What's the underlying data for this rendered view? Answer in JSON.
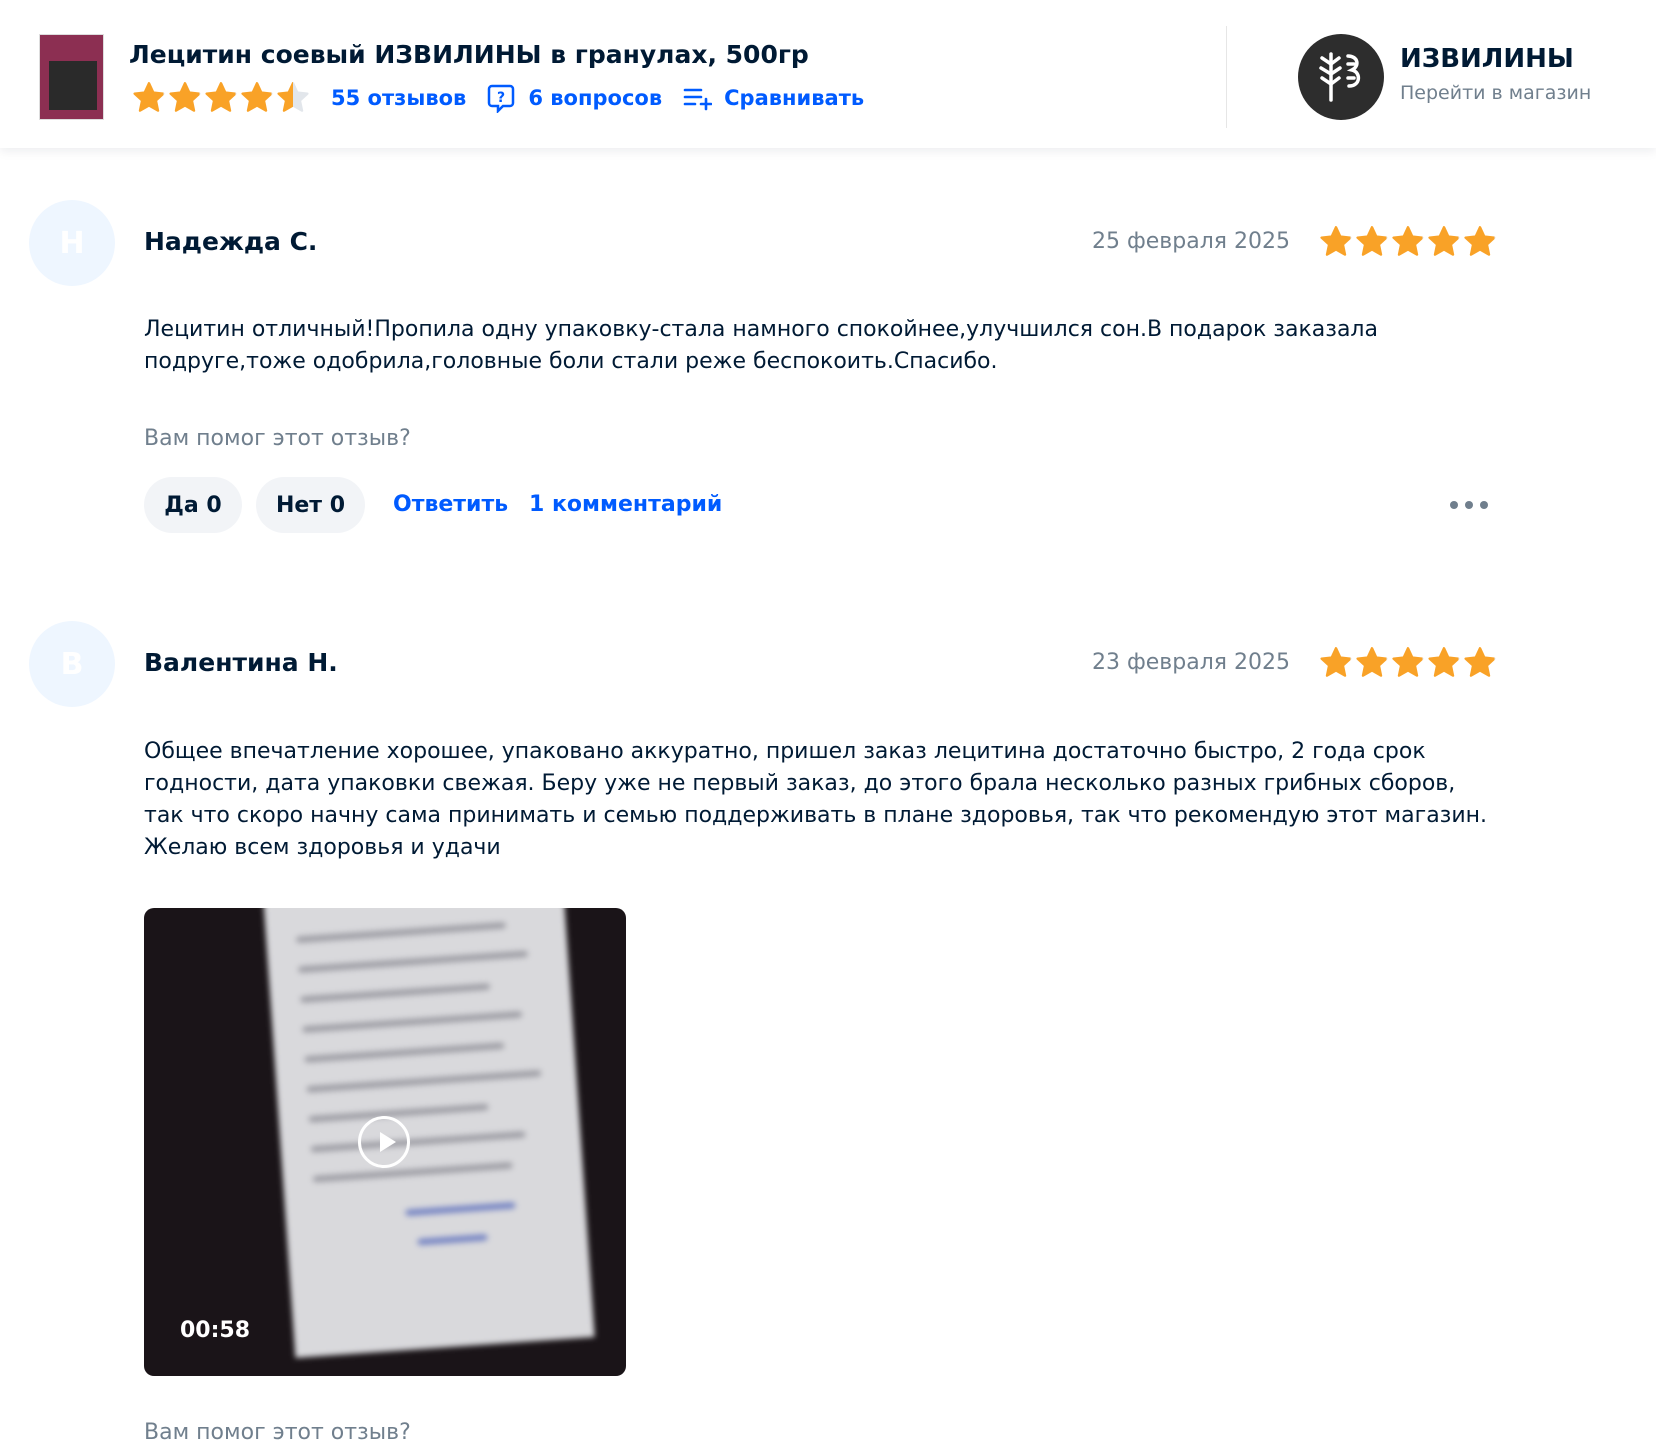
{
  "product": {
    "title": "Лецитин соевый ИЗВИЛИНЫ в гранулах, 500гр",
    "rating": 4.5,
    "reviews_link": "55 отзывов",
    "questions_link": "6 вопросов",
    "compare_link": "Сравнивать"
  },
  "store": {
    "name": "ИЗВИЛИНЫ",
    "link": "Перейти в магазин"
  },
  "colors": {
    "accent": "#005bff",
    "star": "#f9a227",
    "text": "#001a34",
    "muted": "#707f8d"
  },
  "reviews": [
    {
      "initial": "Н",
      "author": "Надежда С.",
      "date": "25 февраля 2025",
      "rating": 5,
      "text": "Лецитин отличный!Пропила одну упаковку-стала намного спокойнее,улучшился сон.В подарок заказала подруге,тоже одобрила,головные боли стали реже беспокоить.Спасибо.",
      "helpful_prompt": "Вам помог этот отзыв?",
      "yes_label": "Да 0",
      "no_label": "Нет 0",
      "reply_label": "Ответить",
      "comments_label": "1 комментарий"
    },
    {
      "initial": "В",
      "author": "Валентина Н.",
      "date": "23 февраля 2025",
      "rating": 5,
      "text": "Общее впечатление хорошее, упаковано аккуратно, пришел заказ лецитина достаточно быстро, 2 года срок годности, дата упаковки свежая. Беру уже не первый заказ, до этого брала несколько разных грибных сборов, так что скоро начну сама принимать и семью поддерживать в плане здоровья, так что рекомендую этот магазин. Желаю всем здоровья и удачи",
      "video_duration": "00:58",
      "helpful_prompt": "Вам помог этот отзыв?"
    }
  ]
}
